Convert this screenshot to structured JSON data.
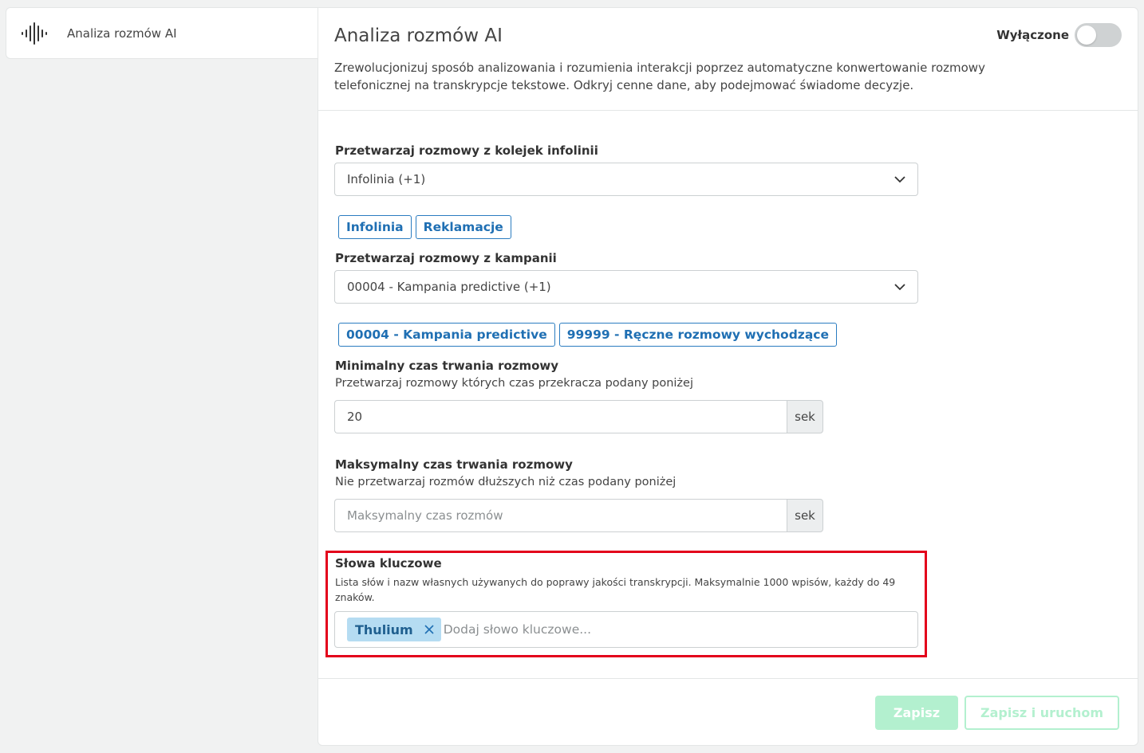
{
  "sidebar": {
    "item_label": "Analiza rozmów AI",
    "item_icon": "waveform-icon"
  },
  "header": {
    "title": "Analiza rozmów AI",
    "toggle_label": "Wyłączone",
    "toggle_on": false,
    "description": "Zrewolucjonizuj sposób analizowania i rozumienia interakcji poprzez automatyczne konwertowanie rozmowy telefonicznej na transkrypcje tekstowe. Odkryj cenne dane, aby podejmować świadome decyzje."
  },
  "queues": {
    "label": "Przetwarzaj rozmowy z kolejek infolinii",
    "selected_text": "Infolinia  (+1)",
    "chips": [
      "Infolinia",
      "Reklamacje"
    ]
  },
  "campaigns": {
    "label": "Przetwarzaj rozmowy z kampanii",
    "selected_text": "00004 - Kampania predictive  (+1)",
    "chips": [
      "00004 - Kampania predictive",
      "99999 - Ręczne rozmowy wychodzące"
    ]
  },
  "min_duration": {
    "label": "Minimalny czas trwania rozmowy",
    "sublabel": "Przetwarzaj rozmowy których czas przekracza podany poniżej",
    "value": "20",
    "unit": "sek"
  },
  "max_duration": {
    "label": "Maksymalny czas trwania rozmowy",
    "sublabel": "Nie przetwarzaj rozmów dłuższych niż czas podany poniżej",
    "placeholder": "Maksymalny czas rozmów",
    "unit": "sek"
  },
  "keywords": {
    "label": "Słowa kluczowe",
    "description": "Lista słów i nazw własnych używanych do poprawy jakości transkrypcji. Maksymalnie 1000 wpisów, każdy do 49 znaków.",
    "tags": [
      "Thulium"
    ],
    "placeholder": "Dodaj słowo kluczowe..."
  },
  "footer": {
    "save_label": "Zapisz",
    "save_run_label": "Zapisz i uruchom"
  },
  "colors": {
    "accent_blue": "#1f6fb3",
    "highlight_red": "#e3001b",
    "button_green_disabled": "#b3f0cf",
    "tag_bg": "#b5dcf2"
  }
}
